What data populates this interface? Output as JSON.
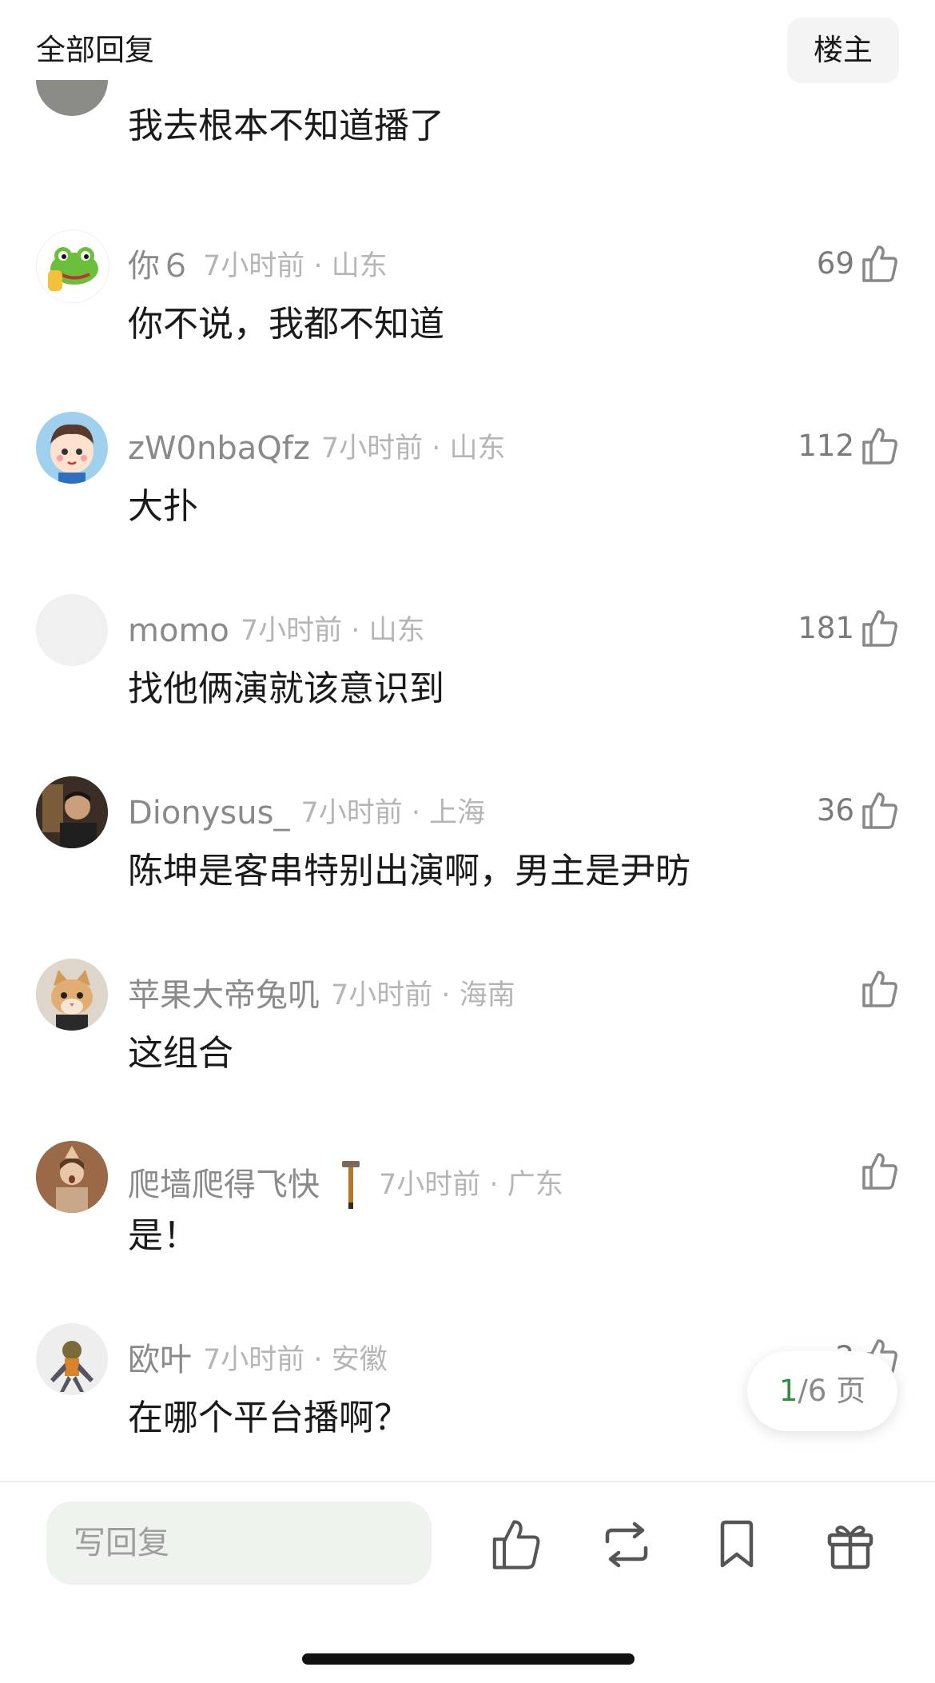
{
  "header": {
    "title": "全部回复",
    "op_button": "楼主"
  },
  "partial_comment": {
    "text": "我去根本不知道播了"
  },
  "comments": [
    {
      "username": "你６",
      "time": "7小时前",
      "location": "山东",
      "text": "你不说，我都不知道",
      "likes": "69",
      "avatar": "frog-avatar"
    },
    {
      "username": "zW0nbaQfz",
      "time": "7小时前",
      "location": "山东",
      "text": "大扑",
      "likes": "112",
      "avatar": "cartoon-baby-avatar"
    },
    {
      "username": "momo",
      "time": "7小时前",
      "location": "山东",
      "text": "找他俩演就该意识到",
      "likes": "181",
      "avatar": "blank-avatar"
    },
    {
      "username": "Dionysus_",
      "time": "7小时前",
      "location": "上海",
      "text": "陈坤是客串特别出演啊，男主是尹昉",
      "likes": "36",
      "avatar": "photo-avatar"
    },
    {
      "username": "苹果大帝兔叽",
      "time": "7小时前",
      "location": "海南",
      "text": "这组合",
      "likes": "",
      "avatar": "cat-avatar"
    },
    {
      "username": "爬墙爬得飞快",
      "time": "7小时前",
      "location": "广东",
      "text": "是！",
      "likes": "",
      "avatar": "person-avatar",
      "badge": "hammer-badge-icon"
    },
    {
      "username": "欧叶",
      "time": "7小时前",
      "location": "安徽",
      "text": "在哪个平台播啊？",
      "likes": "2",
      "avatar": "robot-avatar"
    }
  ],
  "meta_separator": "·",
  "pagination": {
    "current": "1",
    "separator": "/",
    "total": "6",
    "unit": "页"
  },
  "bottom_bar": {
    "reply_placeholder": "写回复",
    "icons": [
      "thumbs-up-icon",
      "repost-icon",
      "bookmark-icon",
      "gift-icon"
    ]
  },
  "colors": {
    "accent_green": "#2f8f3c",
    "input_bg": "#eef3ee",
    "muted_text": "#8a8a8a"
  }
}
